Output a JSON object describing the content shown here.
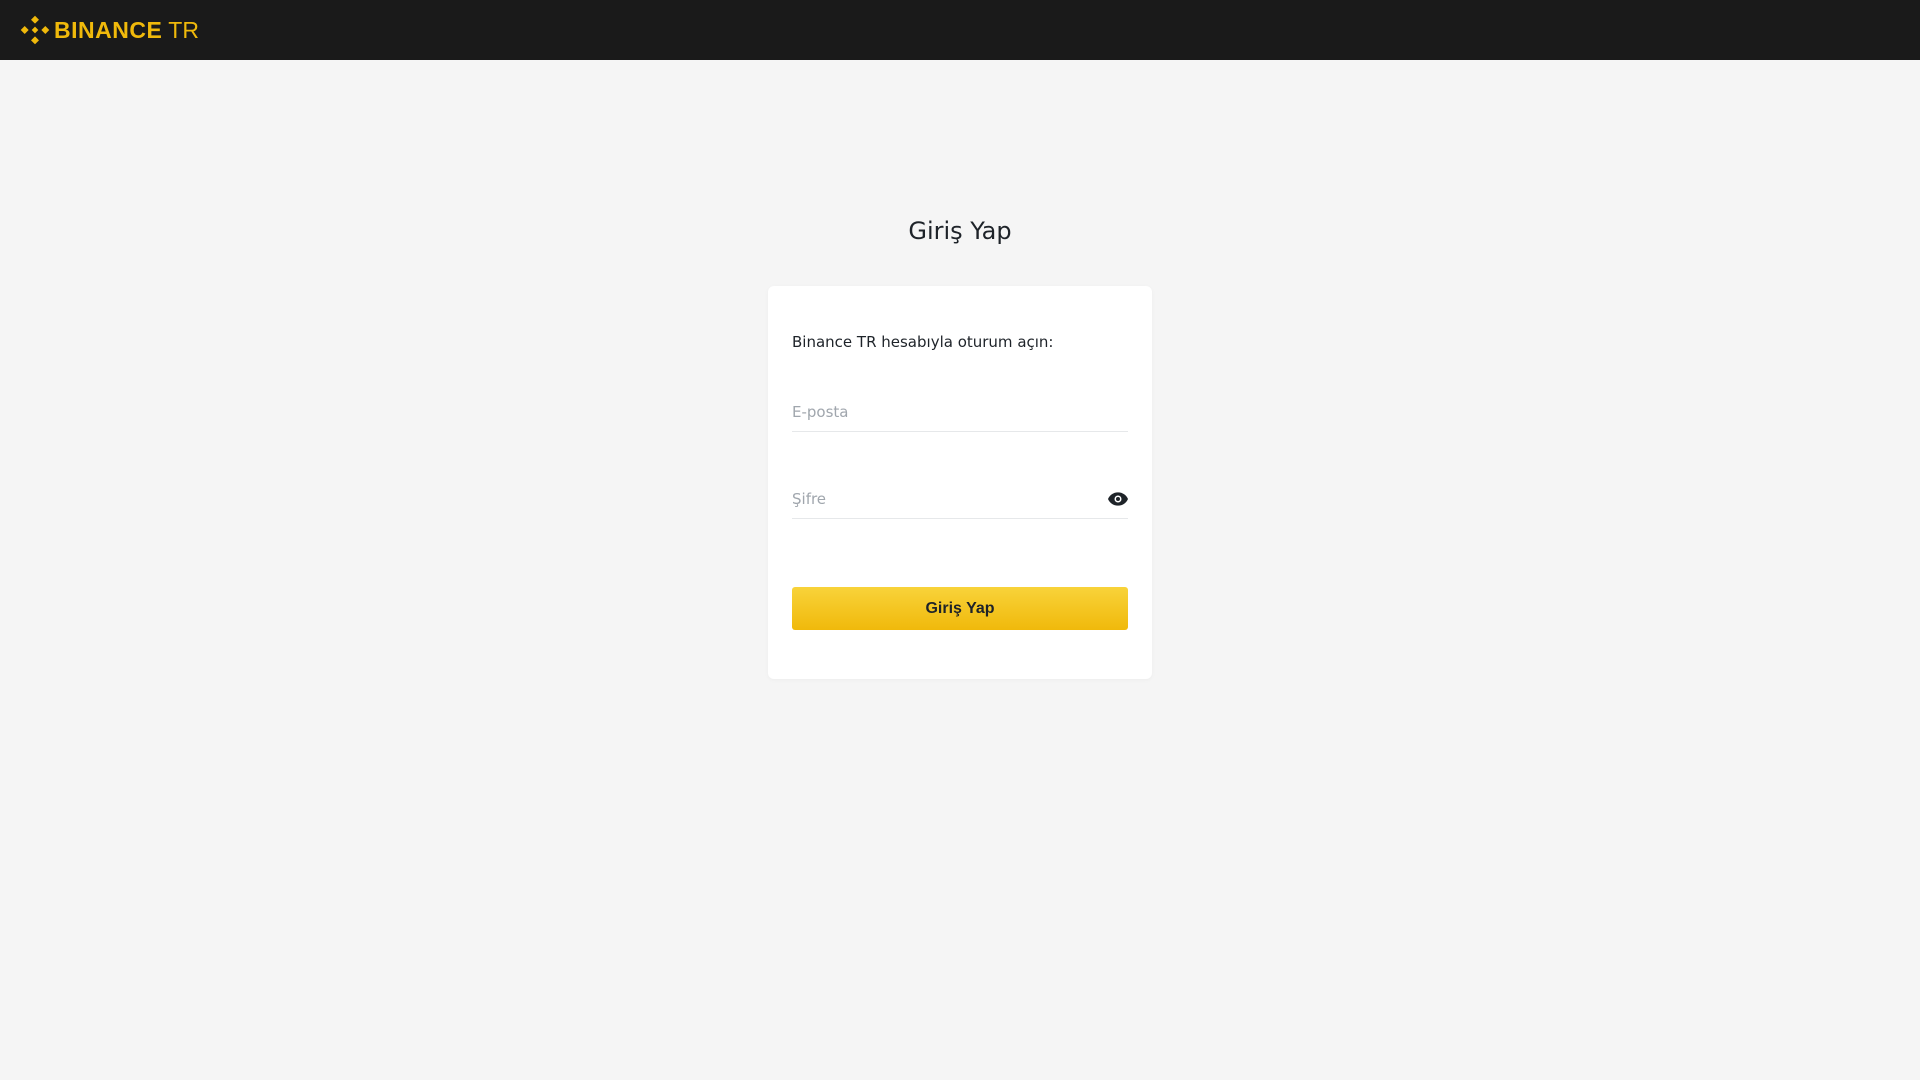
{
  "header": {
    "logo_text": "BINANCE",
    "logo_suffix": "TR",
    "brand_color": "#f0b90b",
    "background_color": "#1a1a1a",
    "logo_icon": "binance-diamond-icon"
  },
  "page": {
    "title": "Giriş Yap",
    "background_color": "#f5f5f5"
  },
  "login_card": {
    "intro_text": "Binance TR hesabıyla oturum açın:",
    "email": {
      "value": "",
      "placeholder": "E-posta"
    },
    "password": {
      "value": "",
      "placeholder": "Şifre",
      "toggle_icon": "eye-icon"
    },
    "submit_label": "Giriş Yap",
    "submit_color": "#f0b90b"
  }
}
